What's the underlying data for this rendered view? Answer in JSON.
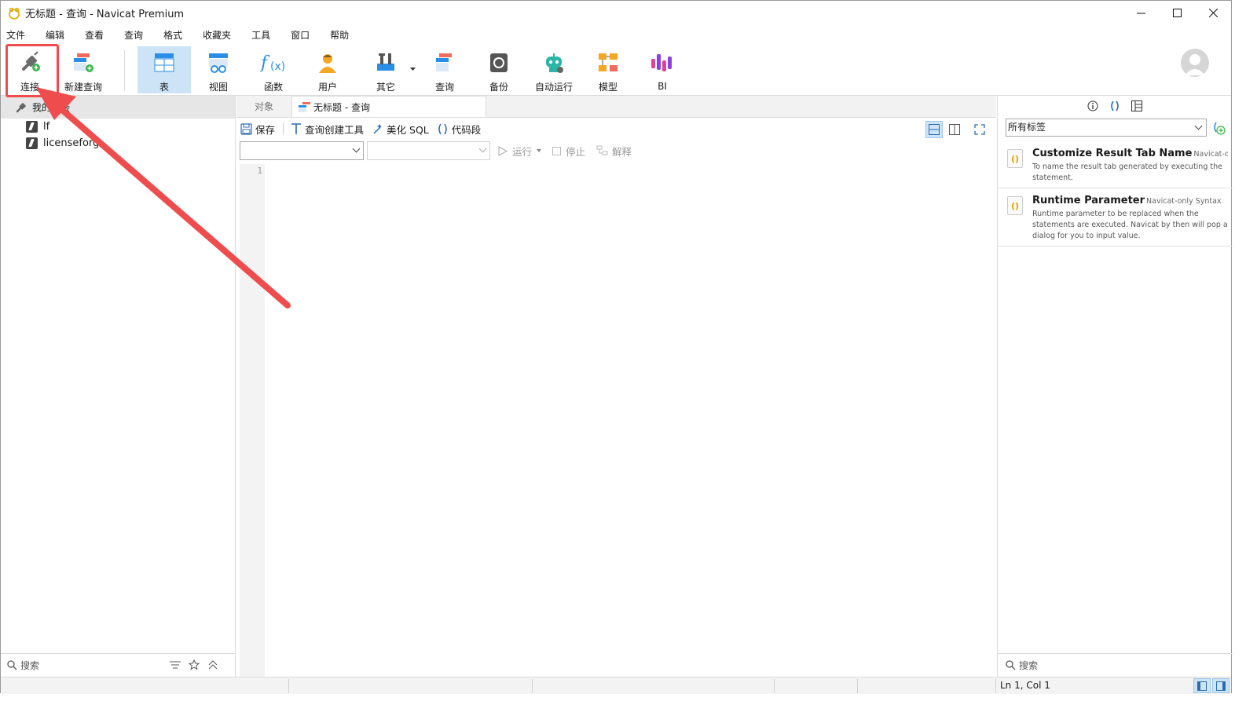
{
  "window": {
    "title": "无标题 - 查询 - Navicat Premium"
  },
  "menu": [
    "文件",
    "编辑",
    "查看",
    "查询",
    "格式",
    "收藏夹",
    "工具",
    "窗口",
    "帮助"
  ],
  "toolbar": {
    "items": [
      {
        "label": "连接",
        "icon": "plug-add-icon"
      },
      {
        "label": "新建查询",
        "icon": "new-query-icon"
      },
      {
        "label": "表",
        "icon": "table-icon"
      },
      {
        "label": "视图",
        "icon": "view-icon"
      },
      {
        "label": "函数",
        "icon": "function-icon"
      },
      {
        "label": "用户",
        "icon": "user-icon"
      },
      {
        "label": "其它",
        "icon": "tools-icon"
      },
      {
        "label": "查询",
        "icon": "query-icon"
      },
      {
        "label": "备份",
        "icon": "backup-icon"
      },
      {
        "label": "自动运行",
        "icon": "robot-icon"
      },
      {
        "label": "模型",
        "icon": "model-icon"
      },
      {
        "label": "BI",
        "icon": "bi-icon"
      }
    ],
    "active": "表"
  },
  "sidebar": {
    "header": "我的连接",
    "items": [
      "lf",
      "licenseforg"
    ],
    "search_placeholder": "搜索"
  },
  "tabs": [
    {
      "label": "对象",
      "active": false
    },
    {
      "label": "无标题 - 查询",
      "active": true
    }
  ],
  "query_toolbar": {
    "save": "保存",
    "builder": "查询创建工具",
    "beautify": "美化 SQL",
    "snippet": "代码段",
    "run": "运行",
    "stop": "停止",
    "explain": "解释"
  },
  "editor": {
    "line_numbers": [
      "1"
    ]
  },
  "right_panel": {
    "tag_select": "所有标签",
    "snippets": [
      {
        "name": "Customize Result Tab Name",
        "tag": "Navicat-only S",
        "desc": "To name the result tab generated by executing the statement."
      },
      {
        "name": "Runtime Parameter",
        "tag": "Navicat-only Syntax",
        "desc": "Runtime parameter to be replaced when the statements are executed. Navicat by then will pop a dialog for you to input value."
      }
    ],
    "search_placeholder": "搜索"
  },
  "statusbar": {
    "position": "Ln 1, Col 1"
  },
  "colors": {
    "accent": "#cde4f7",
    "annotation": "#ef4d4d"
  }
}
